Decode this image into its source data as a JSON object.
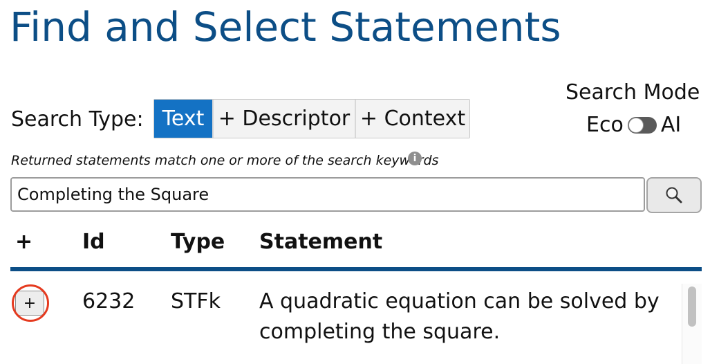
{
  "page": {
    "title": "Find and Select Statements"
  },
  "search_type": {
    "label": "Search Type:",
    "options": [
      "Text",
      "+ Descriptor",
      "+ Context"
    ],
    "selected": "Text"
  },
  "search_mode": {
    "title": "Search Mode",
    "left_label": "Eco",
    "right_label": "AI",
    "ai_enabled": false
  },
  "hint": {
    "text": "Returned statements match one or more of the search keywords",
    "info_icon": "i"
  },
  "search": {
    "value": "Completing the Square",
    "button_icon": "magnifier-icon"
  },
  "table": {
    "headers": {
      "add": "+",
      "id": "Id",
      "type": "Type",
      "statement": "Statement"
    },
    "rows": [
      {
        "add_label": "+",
        "id": "6232",
        "type": "STFk",
        "statement": "A quadratic equation can be solved by completing the square."
      }
    ]
  },
  "colors": {
    "title": "#0c4e86",
    "active_tab": "#1472c4",
    "divider": "#0c4e86",
    "highlight_ring": "#e53a1f"
  }
}
